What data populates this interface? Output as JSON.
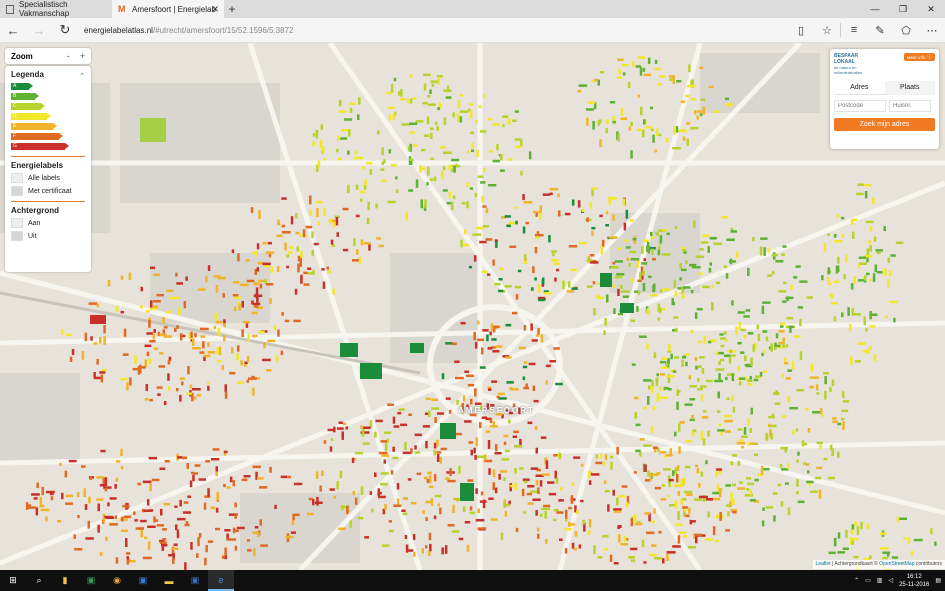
{
  "browser": {
    "tabs": [
      {
        "title": "Specialistisch Vakmanschap",
        "active": false
      },
      {
        "title": "Amersfoort | Energielab",
        "active": true
      }
    ],
    "new_tab": "+",
    "url_host": "energielabelatlas.nl",
    "url_path": "/#utrecht/amersfoort/15/52.1596/5.3872"
  },
  "map": {
    "zoom_label": "Zoom",
    "zoom_minus": "-",
    "zoom_plus": "+",
    "city_label": "AMERSFOORT",
    "attribution_leaflet": "Leaflet",
    "attribution_text": "| Achtergrondkaart ©",
    "attribution_osm": "OpenStreetMap",
    "attribution_tail": "contributors"
  },
  "legend": {
    "title": "Legenda",
    "labels": [
      {
        "letter": "A",
        "color": "#1a8c3a"
      },
      {
        "letter": "B",
        "color": "#5fb135"
      },
      {
        "letter": "C",
        "color": "#b6d22c"
      },
      {
        "letter": "D",
        "color": "#f2e72b"
      },
      {
        "letter": "E",
        "color": "#f0b42a"
      },
      {
        "letter": "F",
        "color": "#e06a23"
      },
      {
        "letter": "G",
        "color": "#c9302a"
      }
    ],
    "energielabels_title": "Energielabels",
    "alle_labels": "Alle labels",
    "met_certificaat": "Met certificaat",
    "achtergrond_title": "Achtergrond",
    "aan": "Aan",
    "uit": "Uit"
  },
  "panel": {
    "brand_line1": "BESPAAR",
    "brand_line2": "LOKAAL",
    "brand_sub1": "de natuur en",
    "brand_sub2": "milieufederaties",
    "meer_info": "Meer info",
    "tab_adres": "Adres",
    "tab_plaats": "Plaats",
    "postcode_placeholder": "Postcode",
    "huisnr_placeholder": "Huisnr.",
    "submit": "Zoek mijn adres"
  },
  "taskbar": {
    "time": "16:12",
    "date": "25-11-2016"
  },
  "colors": {
    "accent": "#f07a22",
    "A": "#1a8c3a",
    "B": "#5fb135",
    "C": "#b6d22c",
    "D": "#f2e72b",
    "E": "#f0b42a",
    "F": "#e06a23",
    "G": "#c9302a"
  }
}
